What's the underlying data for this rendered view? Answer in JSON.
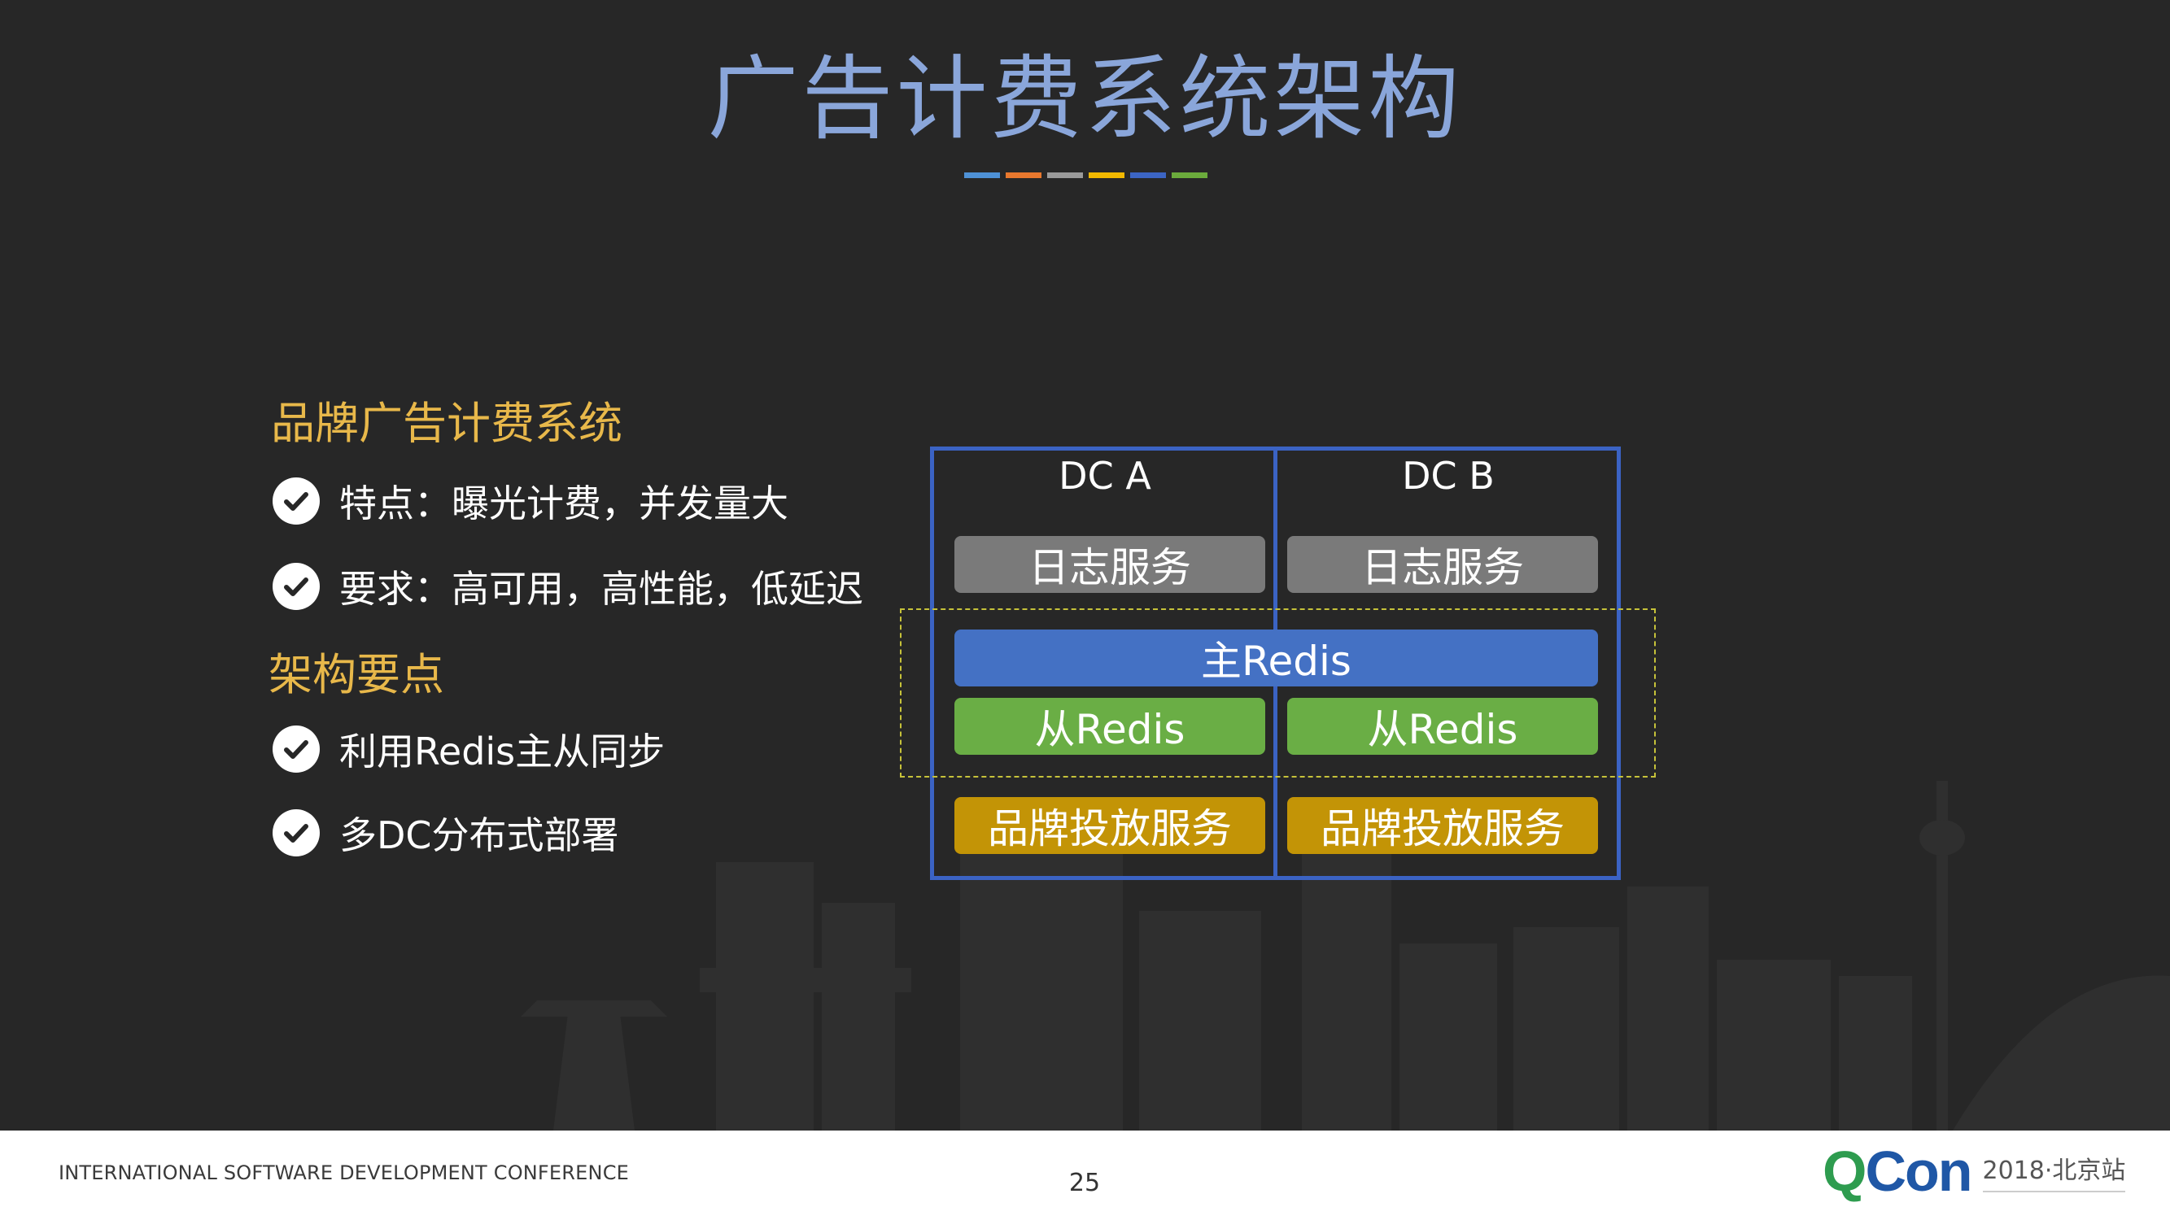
{
  "slide": {
    "title": "广告计费系统架构",
    "title_bar_colors": [
      "#4e91d6",
      "#e8782e",
      "#9a9a9a",
      "#f2b800",
      "#3c65c4",
      "#6bab3c"
    ]
  },
  "left_panel": {
    "section1": {
      "heading": "品牌广告计费系统",
      "bullets": [
        "特点：曝光计费，并发量大",
        "要求：高可用，高性能，低延迟"
      ]
    },
    "section2": {
      "heading": "架构要点",
      "bullets": [
        "利用Redis主从同步",
        "多DC分布式部署"
      ]
    }
  },
  "diagram": {
    "dc_a_label": "DC A",
    "dc_b_label": "DC B",
    "log_service": "日志服务",
    "master_redis": "主Redis",
    "slave_redis": "从Redis",
    "brand_service": "品牌投放服务"
  },
  "footer": {
    "conference": "INTERNATIONAL SOFTWARE DEVELOPMENT CONFERENCE",
    "page_number": "25",
    "logo_q": "Q",
    "logo_con": "Con",
    "logo_subtitle": "2018·北京站"
  }
}
